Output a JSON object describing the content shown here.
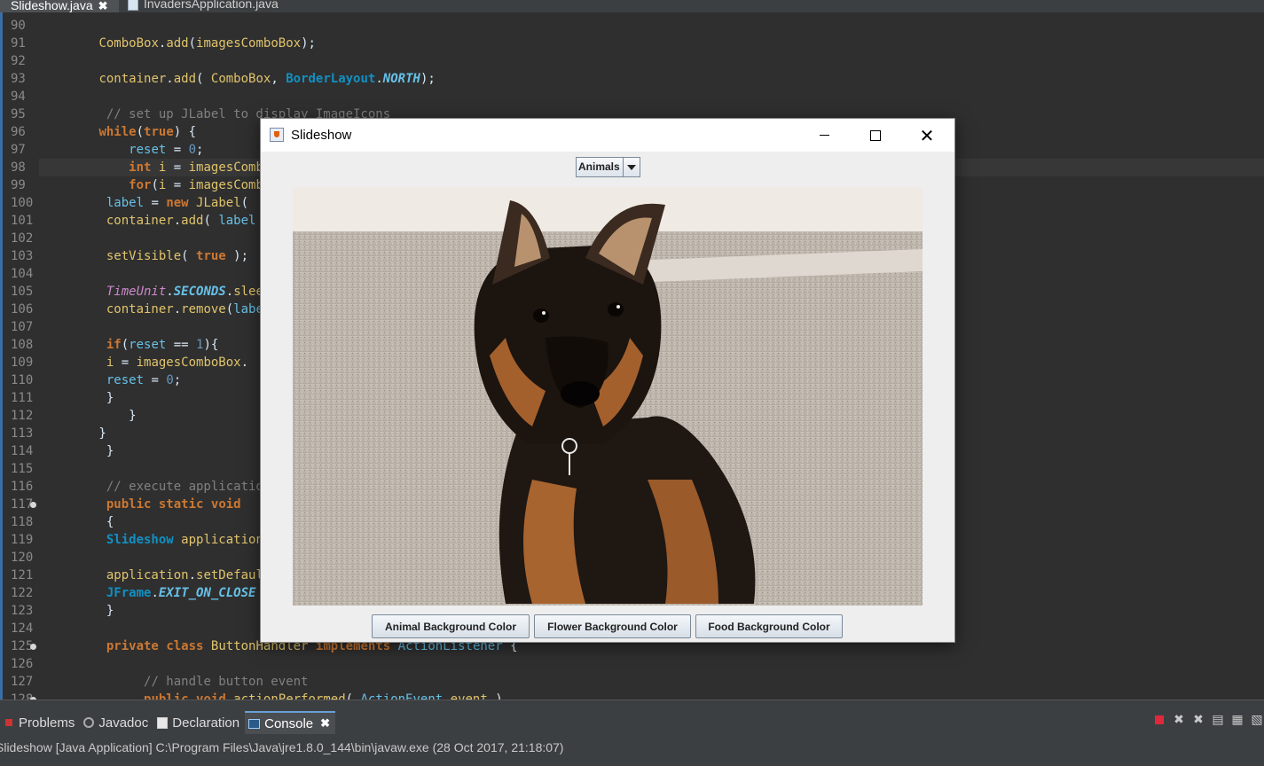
{
  "editor_tabs": [
    {
      "label": "Slideshow.java",
      "active": true,
      "close": "✖"
    },
    {
      "label": "InvadersApplication.java",
      "active": false
    }
  ],
  "code": {
    "lines": [
      {
        "n": "90",
        "fold": false,
        "tokens": []
      },
      {
        "n": "91",
        "fold": false,
        "tokens": [
          {
            "t": "        "
          },
          {
            "t": "ComboBox",
            "c": "mth"
          },
          {
            "t": "."
          },
          {
            "t": "add",
            "c": "mth"
          },
          {
            "t": "("
          },
          {
            "t": "imagesComboBox",
            "c": "mth"
          },
          {
            "t": ");"
          }
        ]
      },
      {
        "n": "92",
        "fold": false,
        "tokens": []
      },
      {
        "n": "93",
        "fold": false,
        "tokens": [
          {
            "t": "        "
          },
          {
            "t": "container",
            "c": "mth"
          },
          {
            "t": "."
          },
          {
            "t": "add",
            "c": "mth"
          },
          {
            "t": "( "
          },
          {
            "t": "ComboBox",
            "c": "mth"
          },
          {
            "t": ", "
          },
          {
            "t": "BorderLayout",
            "c": "typ"
          },
          {
            "t": "."
          },
          {
            "t": "NORTH",
            "c": "cst"
          },
          {
            "t": ");"
          }
        ]
      },
      {
        "n": "94",
        "fold": false,
        "tokens": []
      },
      {
        "n": "95",
        "fold": false,
        "tokens": [
          {
            "t": "         "
          },
          {
            "t": "// set up JLabel to display ImageIcons",
            "c": "cmt"
          }
        ]
      },
      {
        "n": "96",
        "fold": false,
        "tokens": [
          {
            "t": "        "
          },
          {
            "t": "while",
            "c": "kw"
          },
          {
            "t": "("
          },
          {
            "t": "true",
            "c": "kw"
          },
          {
            "t": ") {"
          }
        ]
      },
      {
        "n": "97",
        "fold": false,
        "tokens": [
          {
            "t": "            "
          },
          {
            "t": "reset",
            "c": "fld"
          },
          {
            "t": " = "
          },
          {
            "t": "0",
            "c": "num"
          },
          {
            "t": ";"
          }
        ]
      },
      {
        "n": "98",
        "fold": false,
        "highlight": true,
        "tokens": [
          {
            "t": "            "
          },
          {
            "t": "int",
            "c": "kw"
          },
          {
            "t": " "
          },
          {
            "t": "i",
            "c": "mth"
          },
          {
            "t": " = "
          },
          {
            "t": "imagesComboBox",
            "c": "mth"
          }
        ]
      },
      {
        "n": "99",
        "fold": false,
        "tokens": [
          {
            "t": "            "
          },
          {
            "t": "for",
            "c": "kw"
          },
          {
            "t": "("
          },
          {
            "t": "i",
            "c": "mth"
          },
          {
            "t": " = "
          },
          {
            "t": "imagesComboBox",
            "c": "mth"
          },
          {
            "t": "                                                                 {"
          }
        ]
      },
      {
        "n": "100",
        "fold": false,
        "tokens": [
          {
            "t": "         "
          },
          {
            "t": "label",
            "c": "fld"
          },
          {
            "t": " = "
          },
          {
            "t": "new",
            "c": "kw"
          },
          {
            "t": " "
          },
          {
            "t": "JLabel",
            "c": "mth"
          },
          {
            "t": "("
          }
        ]
      },
      {
        "n": "101",
        "fold": false,
        "tokens": [
          {
            "t": "         "
          },
          {
            "t": "container",
            "c": "mth"
          },
          {
            "t": "."
          },
          {
            "t": "add",
            "c": "mth"
          },
          {
            "t": "( "
          },
          {
            "t": "label",
            "c": "fld"
          }
        ]
      },
      {
        "n": "102",
        "fold": false,
        "tokens": []
      },
      {
        "n": "103",
        "fold": false,
        "tokens": [
          {
            "t": "         "
          },
          {
            "t": "setVisible",
            "c": "mth"
          },
          {
            "t": "( "
          },
          {
            "t": "true",
            "c": "kw"
          },
          {
            "t": " );"
          }
        ]
      },
      {
        "n": "104",
        "fold": false,
        "tokens": []
      },
      {
        "n": "105",
        "fold": false,
        "tokens": [
          {
            "t": "         "
          },
          {
            "t": "TimeUnit",
            "c": "cls"
          },
          {
            "t": "."
          },
          {
            "t": "SECONDS",
            "c": "cst"
          },
          {
            "t": "."
          },
          {
            "t": "sleep",
            "c": "mth"
          }
        ]
      },
      {
        "n": "106",
        "fold": false,
        "tokens": [
          {
            "t": "         "
          },
          {
            "t": "container",
            "c": "mth"
          },
          {
            "t": "."
          },
          {
            "t": "remove",
            "c": "mth"
          },
          {
            "t": "("
          },
          {
            "t": "label",
            "c": "fld"
          }
        ]
      },
      {
        "n": "107",
        "fold": false,
        "tokens": []
      },
      {
        "n": "108",
        "fold": false,
        "tokens": [
          {
            "t": "         "
          },
          {
            "t": "if",
            "c": "kw"
          },
          {
            "t": "("
          },
          {
            "t": "reset",
            "c": "fld"
          },
          {
            "t": " == "
          },
          {
            "t": "1",
            "c": "num"
          },
          {
            "t": "){"
          }
        ]
      },
      {
        "n": "109",
        "fold": false,
        "tokens": [
          {
            "t": "         "
          },
          {
            "t": "i",
            "c": "mth"
          },
          {
            "t": " = "
          },
          {
            "t": "imagesComboBox",
            "c": "mth"
          },
          {
            "t": "."
          }
        ]
      },
      {
        "n": "110",
        "fold": false,
        "tokens": [
          {
            "t": "         "
          },
          {
            "t": "reset",
            "c": "fld"
          },
          {
            "t": " = "
          },
          {
            "t": "0",
            "c": "num"
          },
          {
            "t": ";"
          }
        ]
      },
      {
        "n": "111",
        "fold": false,
        "tokens": [
          {
            "t": "         }"
          }
        ]
      },
      {
        "n": "112",
        "fold": false,
        "tokens": [
          {
            "t": "            }"
          }
        ]
      },
      {
        "n": "113",
        "fold": false,
        "tokens": [
          {
            "t": "        }"
          }
        ]
      },
      {
        "n": "114",
        "fold": false,
        "tokens": [
          {
            "t": "         }"
          }
        ]
      },
      {
        "n": "115",
        "fold": false,
        "tokens": []
      },
      {
        "n": "116",
        "fold": false,
        "tokens": [
          {
            "t": "         "
          },
          {
            "t": "// execute application",
            "c": "cmt"
          }
        ]
      },
      {
        "n": "117",
        "fold": true,
        "tokens": [
          {
            "t": "         "
          },
          {
            "t": "public",
            "c": "kw"
          },
          {
            "t": " "
          },
          {
            "t": "static",
            "c": "kw"
          },
          {
            "t": " "
          },
          {
            "t": "void",
            "c": "kw"
          }
        ]
      },
      {
        "n": "118",
        "fold": false,
        "tokens": [
          {
            "t": "         {"
          }
        ]
      },
      {
        "n": "119",
        "fold": false,
        "tokens": [
          {
            "t": "         "
          },
          {
            "t": "Slideshow",
            "c": "typ"
          },
          {
            "t": " "
          },
          {
            "t": "application",
            "c": "mth"
          }
        ]
      },
      {
        "n": "120",
        "fold": false,
        "tokens": []
      },
      {
        "n": "121",
        "fold": false,
        "tokens": [
          {
            "t": "         "
          },
          {
            "t": "application",
            "c": "mth"
          },
          {
            "t": "."
          },
          {
            "t": "setDefaultCloseOperation",
            "c": "mth"
          }
        ]
      },
      {
        "n": "122",
        "fold": false,
        "tokens": [
          {
            "t": "         "
          },
          {
            "t": "JFrame",
            "c": "typ"
          },
          {
            "t": "."
          },
          {
            "t": "EXIT_ON_CLOSE",
            "c": "cst"
          }
        ]
      },
      {
        "n": "123",
        "fold": false,
        "tokens": [
          {
            "t": "         }"
          }
        ]
      },
      {
        "n": "124",
        "fold": false,
        "tokens": []
      },
      {
        "n": "125",
        "fold": true,
        "tokens": [
          {
            "t": "         "
          },
          {
            "t": "private",
            "c": "kw"
          },
          {
            "t": " "
          },
          {
            "t": "class",
            "c": "kw"
          },
          {
            "t": " "
          },
          {
            "t": "ButtonHandler",
            "c": "mth"
          },
          {
            "t": " "
          },
          {
            "t": "implements",
            "c": "kw"
          },
          {
            "t": " "
          },
          {
            "t": "ActionListener",
            "c": "fld"
          },
          {
            "t": " {"
          }
        ]
      },
      {
        "n": "126",
        "fold": false,
        "tokens": []
      },
      {
        "n": "127",
        "fold": false,
        "tokens": [
          {
            "t": "              "
          },
          {
            "t": "// handle button event",
            "c": "cmt"
          }
        ]
      },
      {
        "n": "128",
        "fold": true,
        "tokens": [
          {
            "t": "              "
          },
          {
            "t": "public",
            "c": "kw"
          },
          {
            "t": " "
          },
          {
            "t": "void",
            "c": "kw"
          },
          {
            "t": " "
          },
          {
            "t": "actionPerformed",
            "c": "mth"
          },
          {
            "t": "( "
          },
          {
            "t": "ActionEvent",
            "c": "fld"
          },
          {
            "t": " "
          },
          {
            "t": "event",
            "c": "mth"
          },
          {
            "t": " )"
          }
        ]
      }
    ]
  },
  "slideshow_window": {
    "title": "Slideshow",
    "combo_value": "Animals",
    "image_subject": "German Shepherd puppy",
    "buttons": {
      "animal": "Animal Background Color",
      "flower": "Flower Background Color",
      "food": "Food Background Color"
    }
  },
  "bottom_panel": {
    "tabs": [
      {
        "label": "Problems",
        "icon": "problems-icon"
      },
      {
        "label": "Javadoc",
        "icon": "javadoc-icon"
      },
      {
        "label": "Declaration",
        "icon": "declaration-icon"
      },
      {
        "label": "Console",
        "icon": "console-icon",
        "active": true,
        "close": "✖"
      }
    ],
    "console_status": "Slideshow [Java Application] C:\\Program Files\\Java\\jre1.8.0_144\\bin\\javaw.exe (28 Oct 2017, 21:18:07)",
    "toolbar_icons": [
      "terminate-icon",
      "remove-launch-icon",
      "remove-all-icon",
      "scroll-lock-icon",
      "show-console-icon",
      "pin-console-icon"
    ]
  },
  "colors": {
    "editor_bg": "#2f2f2f",
    "keyword": "#cc7832",
    "method": "#e0c46c",
    "comment": "#808080",
    "swing_bg": "#eeeeee"
  }
}
